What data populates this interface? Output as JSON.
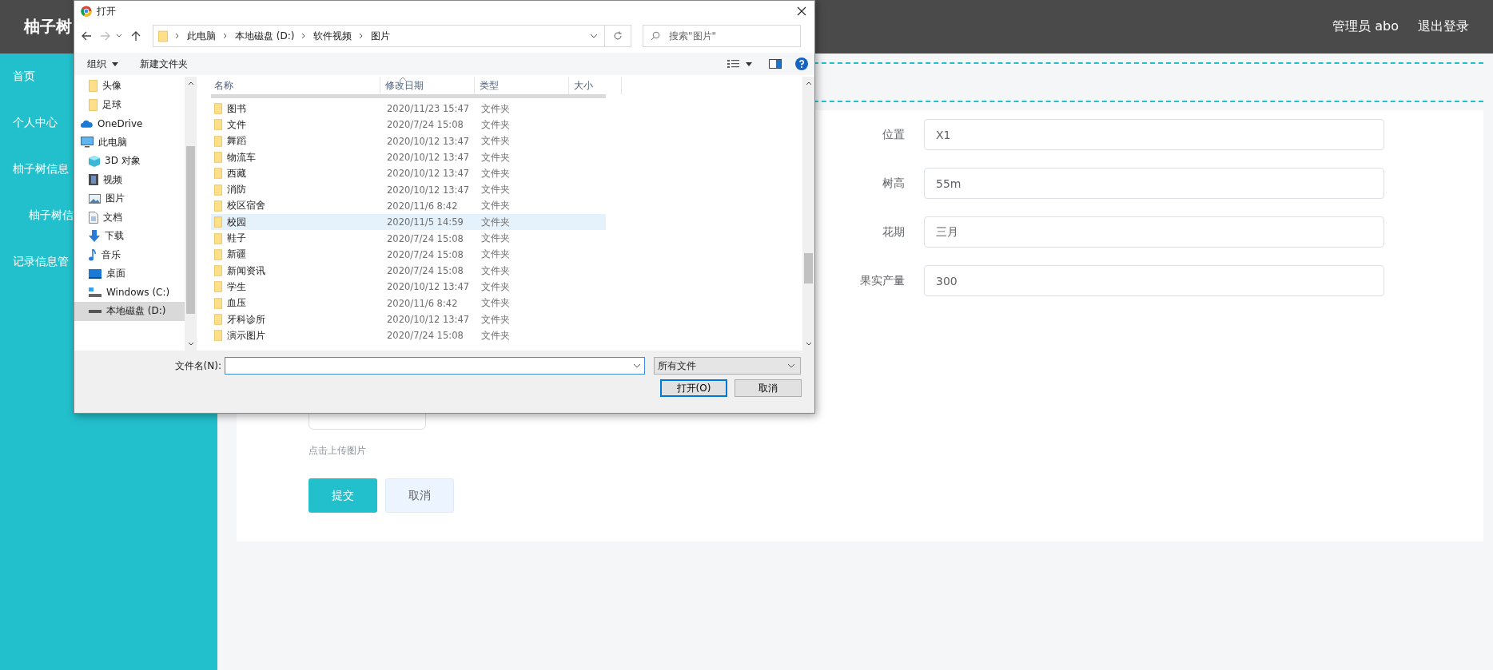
{
  "header": {
    "logo": "柚子树",
    "user": "管理员 abo",
    "logout": "退出登录"
  },
  "sidebar": {
    "items": [
      {
        "label": "首页",
        "sub": false
      },
      {
        "label": "个人中心",
        "sub": false
      },
      {
        "label": "柚子树信息",
        "sub": false
      },
      {
        "label": "柚子树信",
        "sub": true
      },
      {
        "label": "记录信息管",
        "sub": false
      }
    ]
  },
  "form": {
    "fields": [
      {
        "label": "位置",
        "value": "X1"
      },
      {
        "label": "树高",
        "value": "55m"
      },
      {
        "label": "花期",
        "value": "三月"
      },
      {
        "label": "果实产量",
        "value": "300"
      }
    ],
    "upload_hint": "点击上传图片",
    "submit": "提交",
    "cancel": "取消"
  },
  "dialog": {
    "title": "打开",
    "path": [
      "此电脑",
      "本地磁盘 (D:)",
      "软件视频",
      "图片"
    ],
    "search": {
      "placeholder": "搜索\"图片\""
    },
    "toolbar": {
      "organize": "组织",
      "new_folder": "新建文件夹"
    },
    "nav": [
      {
        "kind": "folder",
        "label": "头像",
        "selected": false
      },
      {
        "kind": "folder",
        "label": "足球",
        "selected": false
      },
      {
        "kind": "cloud",
        "label": "OneDrive",
        "selected": false
      },
      {
        "kind": "pc",
        "label": "此电脑",
        "selected": false,
        "children": [
          {
            "kind": "cube",
            "label": "3D 对象",
            "selected": false
          },
          {
            "kind": "video",
            "label": "视频",
            "selected": false
          },
          {
            "kind": "pictures",
            "label": "图片",
            "selected": false
          },
          {
            "kind": "documents",
            "label": "文档",
            "selected": false
          },
          {
            "kind": "downloads",
            "label": "下载",
            "selected": false
          },
          {
            "kind": "music",
            "label": "音乐",
            "selected": false
          },
          {
            "kind": "desktop",
            "label": "桌面",
            "selected": false
          },
          {
            "kind": "system-drive",
            "label": "Windows (C:)",
            "selected": false
          },
          {
            "kind": "drive",
            "label": "本地磁盘 (D:)",
            "selected": true
          }
        ]
      }
    ],
    "columns": [
      "名称",
      "修改日期",
      "类型",
      "大小"
    ],
    "rows": [
      {
        "name": "图书",
        "date": "2020/11/23 15:47",
        "type": "文件夹",
        "selected": false
      },
      {
        "name": "文件",
        "date": "2020/7/24 15:08",
        "type": "文件夹",
        "selected": false
      },
      {
        "name": "舞蹈",
        "date": "2020/10/12 13:47",
        "type": "文件夹",
        "selected": false
      },
      {
        "name": "物流车",
        "date": "2020/10/12 13:47",
        "type": "文件夹",
        "selected": false
      },
      {
        "name": "西藏",
        "date": "2020/10/12 13:47",
        "type": "文件夹",
        "selected": false
      },
      {
        "name": "消防",
        "date": "2020/10/12 13:47",
        "type": "文件夹",
        "selected": false
      },
      {
        "name": "校区宿舍",
        "date": "2020/11/6 8:42",
        "type": "文件夹",
        "selected": false
      },
      {
        "name": "校园",
        "date": "2020/11/5 14:59",
        "type": "文件夹",
        "selected": true
      },
      {
        "name": "鞋子",
        "date": "2020/7/24 15:08",
        "type": "文件夹",
        "selected": false
      },
      {
        "name": "新疆",
        "date": "2020/7/24 15:08",
        "type": "文件夹",
        "selected": false
      },
      {
        "name": "新闻资讯",
        "date": "2020/7/24 15:08",
        "type": "文件夹",
        "selected": false
      },
      {
        "name": "学生",
        "date": "2020/10/12 13:47",
        "type": "文件夹",
        "selected": false
      },
      {
        "name": "血压",
        "date": "2020/11/6 8:42",
        "type": "文件夹",
        "selected": false
      },
      {
        "name": "牙科诊所",
        "date": "2020/10/12 13:47",
        "type": "文件夹",
        "selected": false
      },
      {
        "name": "演示图片",
        "date": "2020/7/24 15:08",
        "type": "文件夹",
        "selected": false
      }
    ],
    "filename_label": "文件名(N):",
    "filter": "所有文件",
    "open": "打开(O)",
    "cancel": "取消"
  }
}
